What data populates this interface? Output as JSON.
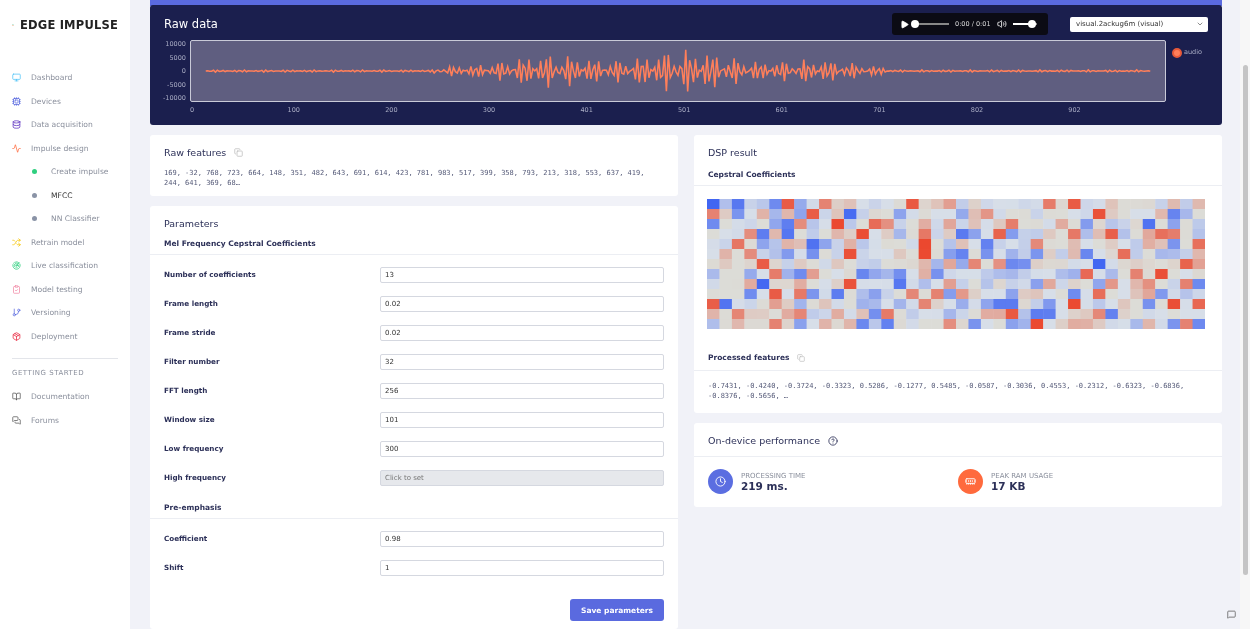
{
  "brand": {
    "name": "EDGE IMPULSE"
  },
  "sidebar": {
    "items": [
      {
        "label": "Dashboard",
        "selected": false
      },
      {
        "label": "Devices",
        "selected": false
      },
      {
        "label": "Data acquisition",
        "selected": false
      },
      {
        "label": "Impulse design",
        "selected": false,
        "children": [
          {
            "label": "Create impulse",
            "selected": false,
            "color": "#2fcf7f"
          },
          {
            "label": "MFCC",
            "selected": true,
            "color": "#8a93a6"
          },
          {
            "label": "NN Classifier",
            "selected": false,
            "color": "#8a93a6"
          }
        ]
      },
      {
        "label": "Retrain model",
        "selected": false
      },
      {
        "label": "Live classification",
        "selected": false
      },
      {
        "label": "Model testing",
        "selected": false
      },
      {
        "label": "Versioning",
        "selected": false
      },
      {
        "label": "Deployment",
        "selected": false
      }
    ],
    "section_title": "GETTING STARTED",
    "links": [
      {
        "label": "Documentation"
      },
      {
        "label": "Forums"
      }
    ]
  },
  "raw_data": {
    "title": "Raw data",
    "player": {
      "time": "0:00 / 0:01",
      "level": 0,
      "volume": {
        "level": 0.8
      }
    },
    "sample_select": {
      "value": "visual.2ackug6m (visual)"
    },
    "yticks": [
      "10000",
      "5000",
      "0",
      "-5000",
      "-10000"
    ],
    "xticks": [
      "0",
      "100",
      "200",
      "300",
      "401",
      "501",
      "601",
      "701",
      "802",
      "902"
    ],
    "legend": {
      "label": "audio",
      "color": "#ff7f5a"
    }
  },
  "raw_features": {
    "title": "Raw features",
    "values": "169, -32, 768, 723, 664, 148, 351, 482, 643, 691, 614, 423, 781, 983, 517, 399, 358, 793, 213, 318, 553, 637, 419, 244, 641, 369, 68…"
  },
  "parameters": {
    "title": "Parameters",
    "sections": [
      {
        "title": "Mel Frequency Cepstral Coefficients",
        "fields": [
          {
            "label": "Number of coefficients",
            "value": "13",
            "disabled": false
          },
          {
            "label": "Frame length",
            "value": "0.02",
            "disabled": false
          },
          {
            "label": "Frame stride",
            "value": "0.02",
            "disabled": false
          },
          {
            "label": "Filter number",
            "value": "32",
            "disabled": false
          },
          {
            "label": "FFT length",
            "value": "256",
            "disabled": false
          },
          {
            "label": "Window size",
            "value": "101",
            "disabled": false
          },
          {
            "label": "Low frequency",
            "value": "300",
            "disabled": false
          },
          {
            "label": "High frequency",
            "placeholder": "Click to set",
            "disabled": true
          }
        ]
      },
      {
        "title": "Pre-emphasis",
        "fields": [
          {
            "label": "Coefficient",
            "value": "0.98",
            "disabled": false
          },
          {
            "label": "Shift",
            "value": "1",
            "disabled": false
          }
        ]
      }
    ],
    "save_button": "Save parameters"
  },
  "dsp_result": {
    "title": "DSP result",
    "subtitle": "Cepstral Coefficients",
    "processed_title": "Processed features",
    "processed_values": "-0.7431, -0.4240, -0.3724, -0.3323, 0.5286, -0.1277, 0.5485, -0.0587, -0.3036, 0.4553, -0.2312, -0.6323, -0.6836, -0.8376, -0.5656, …"
  },
  "performance": {
    "title": "On-device performance",
    "metrics": [
      {
        "label": "PROCESSING TIME",
        "value": "219 ms.",
        "color": "#5b6ee1"
      },
      {
        "label": "PEAK RAM USAGE",
        "value": "17 KB",
        "color": "#ff6a3d"
      }
    ]
  }
}
